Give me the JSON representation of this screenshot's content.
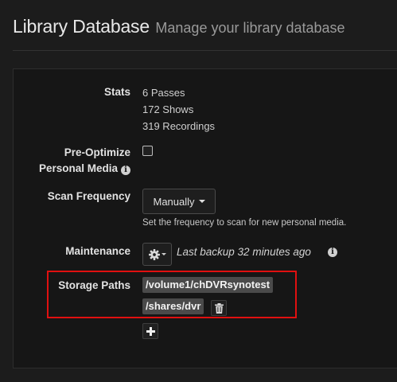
{
  "header": {
    "title": "Library Database",
    "subtitle": "Manage your library database"
  },
  "stats": {
    "label": "Stats",
    "lines": [
      "6 Passes",
      "172 Shows",
      "319 Recordings"
    ]
  },
  "pre_optimize": {
    "label_line1": "Pre-Optimize",
    "label_line2": "Personal Media",
    "checked": false
  },
  "scan_frequency": {
    "label": "Scan Frequency",
    "selected": "Manually",
    "help": "Set the frequency to scan for new personal media."
  },
  "maintenance": {
    "label": "Maintenance",
    "last_backup": "Last backup 32 minutes ago"
  },
  "storage_paths": {
    "label": "Storage Paths",
    "paths": [
      "/volume1/chDVRsynotest",
      "/shares/dvr"
    ]
  },
  "icons": {
    "info": "info-circle-icon",
    "gear": "gear-icon",
    "trash": "trash-icon",
    "add": "plus-icon"
  },
  "colors": {
    "highlight": "#e01010",
    "background": "#1c1c1c",
    "tag": "#4a4a4a"
  }
}
